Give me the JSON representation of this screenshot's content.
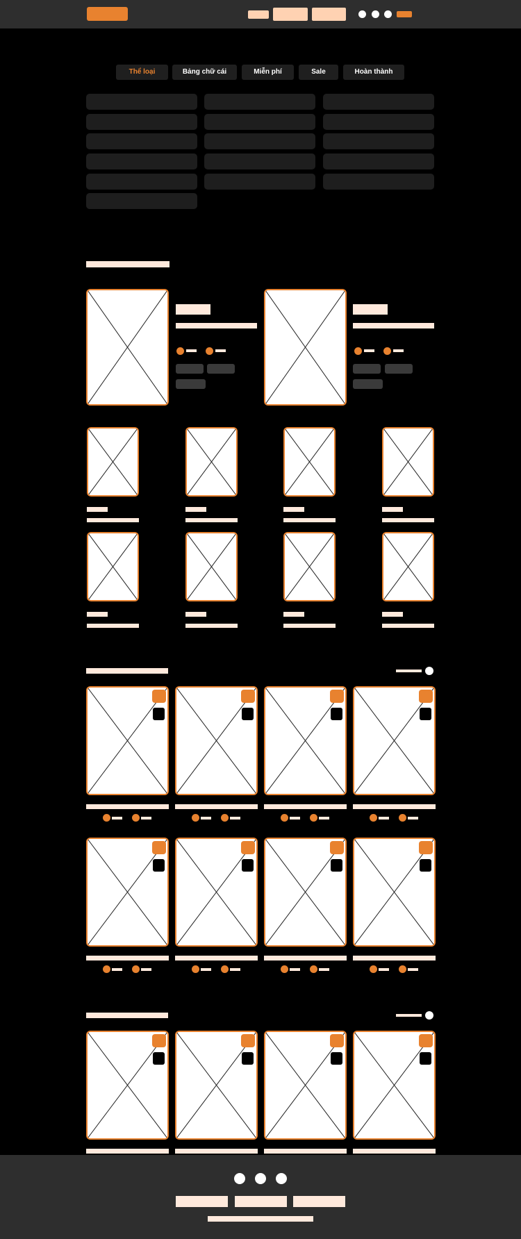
{
  "colors": {
    "accent": "#e8822f",
    "accent_light": "#ffd2b2",
    "bar_fill": "#ffe9dc",
    "background": "#000000",
    "header_bg": "#2e2e2e",
    "card_bg": "#1e1e1e"
  },
  "nav": {
    "tabs": [
      {
        "label": "Thể loại",
        "active": true
      },
      {
        "label": "Bảng chữ cái",
        "active": false
      },
      {
        "label": "Miễn phí",
        "active": false
      },
      {
        "label": "Sale",
        "active": false
      },
      {
        "label": "Hoàn thành",
        "active": false
      }
    ]
  },
  "icons": {
    "placeholder": "image-placeholder-icon",
    "rating": "circle-icon",
    "toggle": "toggle-icon"
  }
}
